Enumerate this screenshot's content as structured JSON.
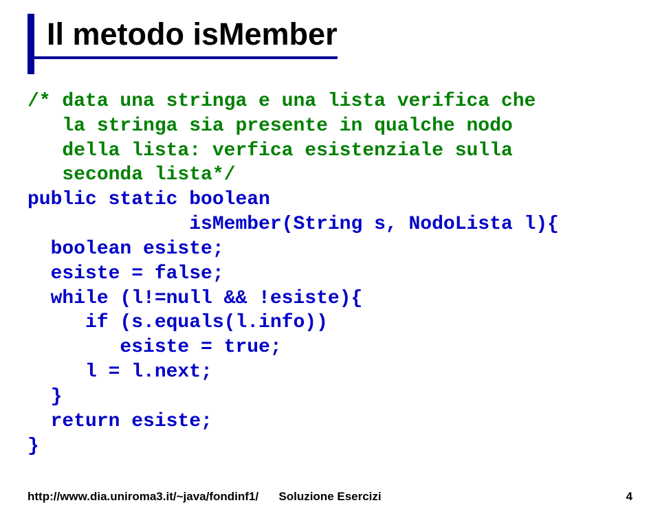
{
  "title": "Il metodo isMember",
  "code": {
    "comment": "/* data una stringa e una lista verifica che\n   la stringa sia presente in qualche nodo\n   della lista: verfica esistenziale sulla\n   seconda lista*/",
    "line1": "public static boolean",
    "line2": "              isMember(String s, NodoLista l){",
    "line3": "  boolean esiste;",
    "line4": "  esiste = false;",
    "line5": "  while (l!=null && !esiste){",
    "line6": "     if (s.equals(l.info))",
    "line7": "        esiste = true;",
    "line8": "     l = l.next;",
    "line9": "  }",
    "line10": "  return esiste;",
    "line11": "}"
  },
  "footer": {
    "left": "http://www.dia.uniroma3.it/~java/fondinf1/",
    "center": "Soluzione Esercizi",
    "right": "4"
  }
}
